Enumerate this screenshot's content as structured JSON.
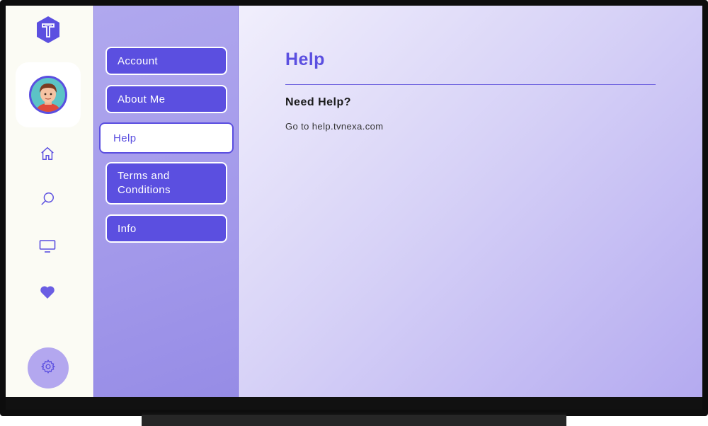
{
  "app": {
    "brand": "T"
  },
  "menu": {
    "items": [
      {
        "label": "Account",
        "active": false
      },
      {
        "label": "About Me",
        "active": false
      },
      {
        "label": "Help",
        "active": true
      },
      {
        "label": "Terms and Conditions",
        "active": false
      },
      {
        "label": "Info",
        "active": false
      }
    ]
  },
  "rail": {
    "icons": [
      "home-icon",
      "search-icon",
      "tv-icon",
      "heart-icon",
      "gear-icon"
    ]
  },
  "content": {
    "title": "Help",
    "subtitle": "Need Help?",
    "text": "Go to help.tvnexa.com"
  },
  "colors": {
    "accent": "#5b4fe0",
    "rail_bg": "#fbfbf4",
    "settings_bg": "#b3a7ef"
  }
}
